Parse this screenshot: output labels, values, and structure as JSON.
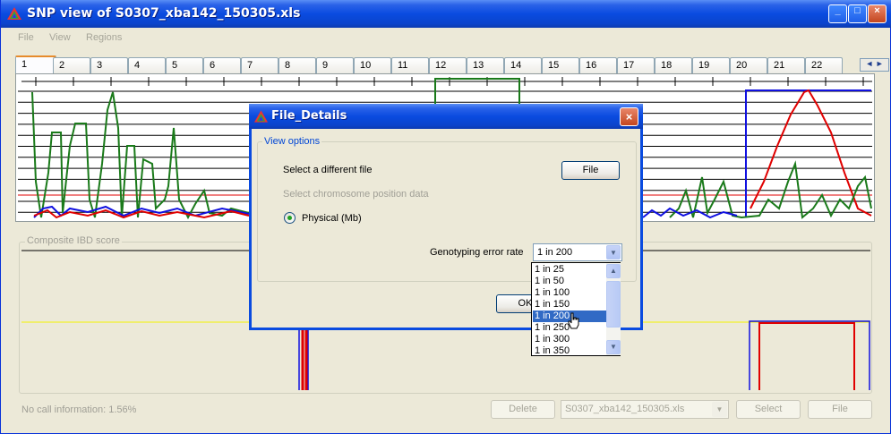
{
  "window": {
    "title": "SNP view of S0307_xba142_150305.xls",
    "controls": [
      "_",
      "□",
      "×"
    ]
  },
  "menu": [
    "File",
    "View",
    "Regions"
  ],
  "tabs": [
    "1",
    "2",
    "3",
    "4",
    "5",
    "6",
    "7",
    "8",
    "9",
    "10",
    "11",
    "12",
    "13",
    "14",
    "15",
    "16",
    "17",
    "18",
    "19",
    "20",
    "21",
    "22"
  ],
  "active_tab": "1",
  "tab_scroll": {
    "left": "◄",
    "right": "►"
  },
  "composite": {
    "legend": "Composite IBD score"
  },
  "status": {
    "no_call": "No call information: 1.56%"
  },
  "bottom": {
    "delete": "Delete",
    "file_combo": "S0307_xba142_150305.xls",
    "select": "Select",
    "file": "File"
  },
  "colors": {
    "green": "#1a7a1a",
    "blue": "#1010e0",
    "red": "#e00000",
    "yellow": "#f4f400",
    "accent": "#0a4be0"
  },
  "dialog": {
    "title": "File_Details",
    "group": "View options",
    "select_file_label": "Select a different file",
    "file_button": "File",
    "chromosome_label": "Select chromosome position data",
    "physical": "Physical (Mb)",
    "error_rate_label": "Genotyping error rate",
    "error_rate_value": "1 in 200",
    "ok": "OK",
    "options": [
      "1 in 25",
      "1 in 50",
      "1 in 100",
      "1 in 150",
      "1 in 200",
      "1 in 250",
      "1 in 300",
      "1 in 350"
    ],
    "selected_option": "1 in 200"
  }
}
